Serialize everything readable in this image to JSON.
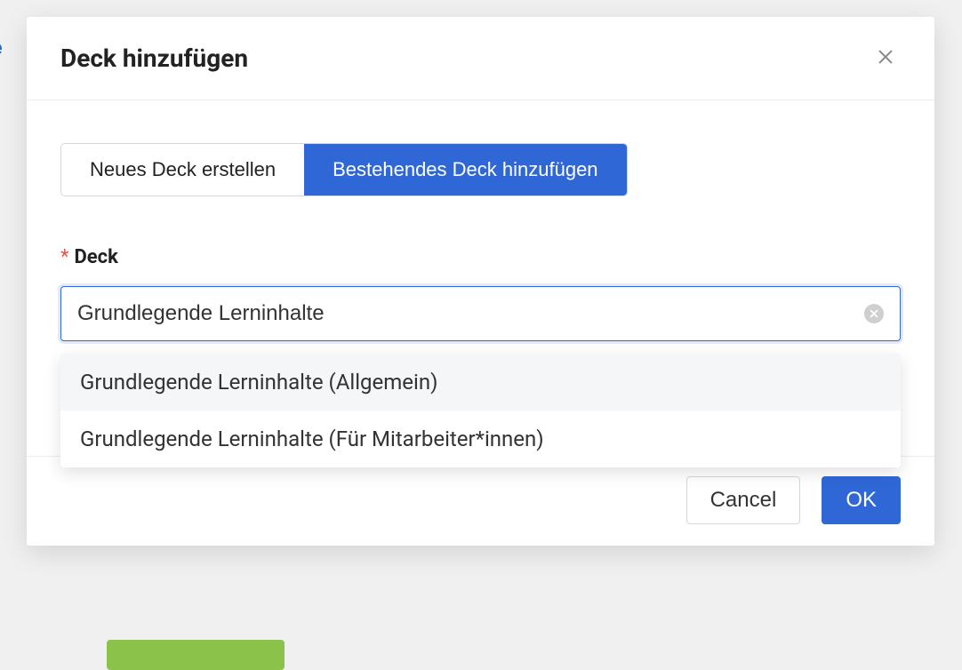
{
  "modal": {
    "title": "Deck hinzufügen",
    "tabs": {
      "new": "Neues Deck erstellen",
      "existing": "Bestehendes Deck hinzufügen"
    },
    "field": {
      "label": "Deck",
      "value": "Grundlegende Lerninhalte",
      "options": [
        "Grundlegende Lerninhalte (Allgemein)",
        "Grundlegende Lerninhalte (Für Mitarbeiter*innen)"
      ]
    },
    "buttons": {
      "cancel": "Cancel",
      "ok": "OK"
    }
  }
}
